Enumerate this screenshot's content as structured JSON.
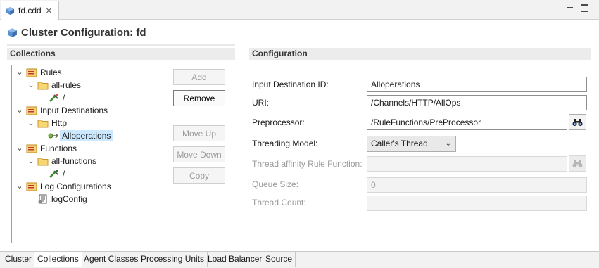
{
  "editor_tab": {
    "title": "fd.cdd",
    "close": "✕"
  },
  "window_buttons": {
    "minimize": "minimize",
    "maximize": "maximize"
  },
  "page_title": "Cluster Configuration: fd",
  "collections": {
    "header": "Collections",
    "tree": [
      {
        "label": "Rules",
        "icon": "folder-group-icon",
        "expanded": true
      },
      {
        "label": "all-rules",
        "icon": "folder-icon",
        "expanded": true
      },
      {
        "label": "/",
        "icon": "rule-plug-icon"
      },
      {
        "label": "Input Destinations",
        "icon": "folder-group-icon",
        "expanded": true
      },
      {
        "label": "Http",
        "icon": "folder-icon",
        "expanded": true
      },
      {
        "label": "Alloperations",
        "icon": "destination-icon",
        "selected": true
      },
      {
        "label": "Functions",
        "icon": "folder-group-icon",
        "expanded": true
      },
      {
        "label": "all-functions",
        "icon": "folder-icon",
        "expanded": true
      },
      {
        "label": "/",
        "icon": "function-plug-icon"
      },
      {
        "label": "Log Configurations",
        "icon": "folder-group-icon",
        "expanded": true
      },
      {
        "label": "logConfig",
        "icon": "log-config-icon"
      }
    ],
    "buttons": {
      "add": "Add",
      "remove": "Remove",
      "move_up": "Move Up",
      "move_down": "Move Down",
      "copy": "Copy"
    }
  },
  "configuration": {
    "header": "Configuration",
    "input_destination_id": {
      "label": "Input Destination ID:",
      "value": "Alloperations"
    },
    "uri": {
      "label": "URI:",
      "value": "/Channels/HTTP/AllOps"
    },
    "preprocessor": {
      "label": "Preprocessor:",
      "value": "/RuleFunctions/PreProcessor"
    },
    "threading_model": {
      "label": "Threading Model:",
      "value": "Caller's Thread",
      "chevron": "⌄"
    },
    "thread_affinity": {
      "label": "Thread affinity Rule Function:",
      "value": ""
    },
    "queue_size": {
      "label": "Queue Size:",
      "value": "0"
    },
    "thread_count": {
      "label": "Thread Count:",
      "value": ""
    }
  },
  "bottom_tabs": [
    "Cluster",
    "Collections",
    "Agent Classes",
    "Processing Units",
    "Load Balancer",
    "Source"
  ],
  "active_bottom_tab": "Collections",
  "colors": {
    "folder": "#e8b33a",
    "selection": "#cce8ff",
    "header_bg": "#ececec",
    "cube": "#5a8fd0"
  }
}
